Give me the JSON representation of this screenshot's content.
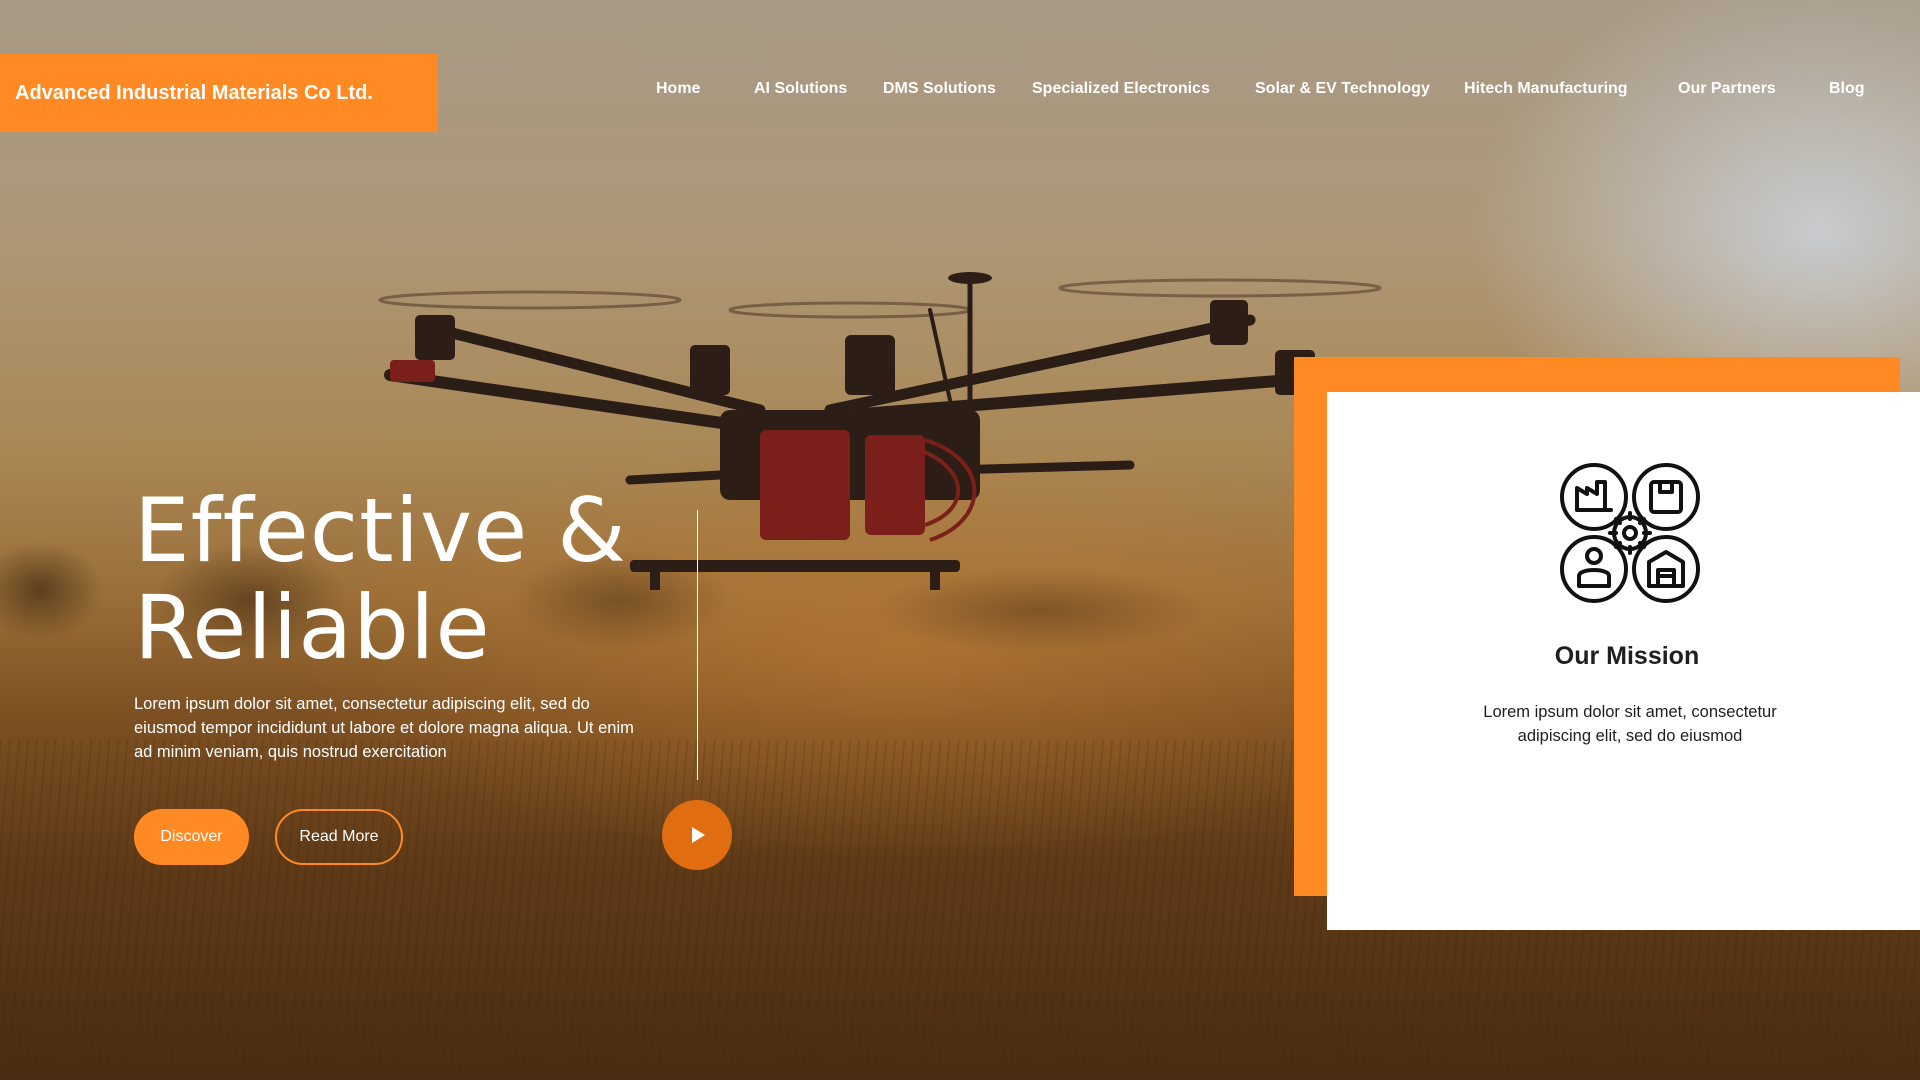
{
  "brand": {
    "name": "Advanced Industrial Materials Co Ltd.",
    "accent_color": "#ff8a24",
    "dark_accent_color": "#e06d0f"
  },
  "nav": {
    "items": [
      {
        "label": "Home"
      },
      {
        "label": "AI Solutions"
      },
      {
        "label": "DMS Solutions"
      },
      {
        "label": "Specialized Electronics"
      },
      {
        "label": "Solar & EV Technology"
      },
      {
        "label": "Hitech Manufacturing"
      },
      {
        "label": "Our Partners"
      },
      {
        "label": "Blog"
      }
    ]
  },
  "hero": {
    "title_line1": "Effective &",
    "title_line2": "Reliable",
    "description": "Lorem ipsum dolor sit amet, consectetur adipiscing elit, sed do eiusmod tempor incididunt ut labore et dolore magna aliqua. Ut enim ad minim veniam, quis nostrud exercitation",
    "discover_label": "Discover",
    "read_more_label": "Read More",
    "play_icon": "play-icon",
    "background_image": "drone-over-field-sunset"
  },
  "mission_card": {
    "icon": "industry-gear-icon",
    "title": "Our Mission",
    "text": "Lorem ipsum dolor sit amet, consectetur adipiscing elit, sed do eiusmod"
  }
}
